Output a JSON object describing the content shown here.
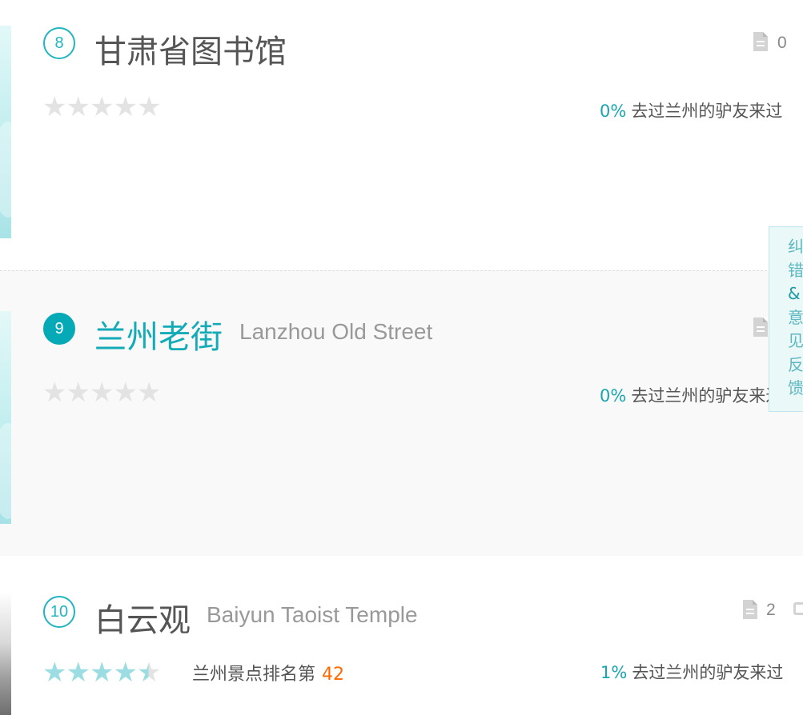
{
  "items": [
    {
      "rank": "8",
      "title_cn": "甘肃省图书馆",
      "title_en": "",
      "rating": 0,
      "stars": [
        "★",
        "★",
        "★",
        "★",
        "★"
      ],
      "city_rank_label": "",
      "city_rank_value": "",
      "visited_percent": "0%",
      "visited_text": "去过兰州的驴友来过",
      "doc_count": "0"
    },
    {
      "rank": "9",
      "title_cn": "兰州老街",
      "title_en": "Lanzhou Old Street",
      "rating": 0,
      "stars": [
        "★",
        "★",
        "★",
        "★",
        "★"
      ],
      "city_rank_label": "",
      "city_rank_value": "",
      "visited_percent": "0%",
      "visited_text": "去过兰州的驴友来过",
      "doc_count": ""
    },
    {
      "rank": "10",
      "title_cn": "白云观",
      "title_en": "Baiyun Taoist Temple",
      "rating": 4.5,
      "stars": [
        "★",
        "★",
        "★",
        "★",
        "★"
      ],
      "city_rank_label": "兰州景点排名第",
      "city_rank_value": "42",
      "visited_percent": "1%",
      "visited_text": "去过兰州的驴友来过",
      "doc_count": "2"
    }
  ],
  "feedback": {
    "chars": [
      "纠",
      "错",
      "&",
      "意",
      "见",
      "反",
      "馈"
    ]
  },
  "colors": {
    "accent": "#12abb7",
    "accent_badge": "#06a9b6",
    "star_on": "#9bdde3",
    "star_off": "#e3e3e3",
    "rank_number": "#ff6a00",
    "text": "#555555",
    "text_light": "#999999"
  },
  "icons": {
    "doc": "document-icon",
    "comment": "comment-icon",
    "star": "star-icon"
  }
}
